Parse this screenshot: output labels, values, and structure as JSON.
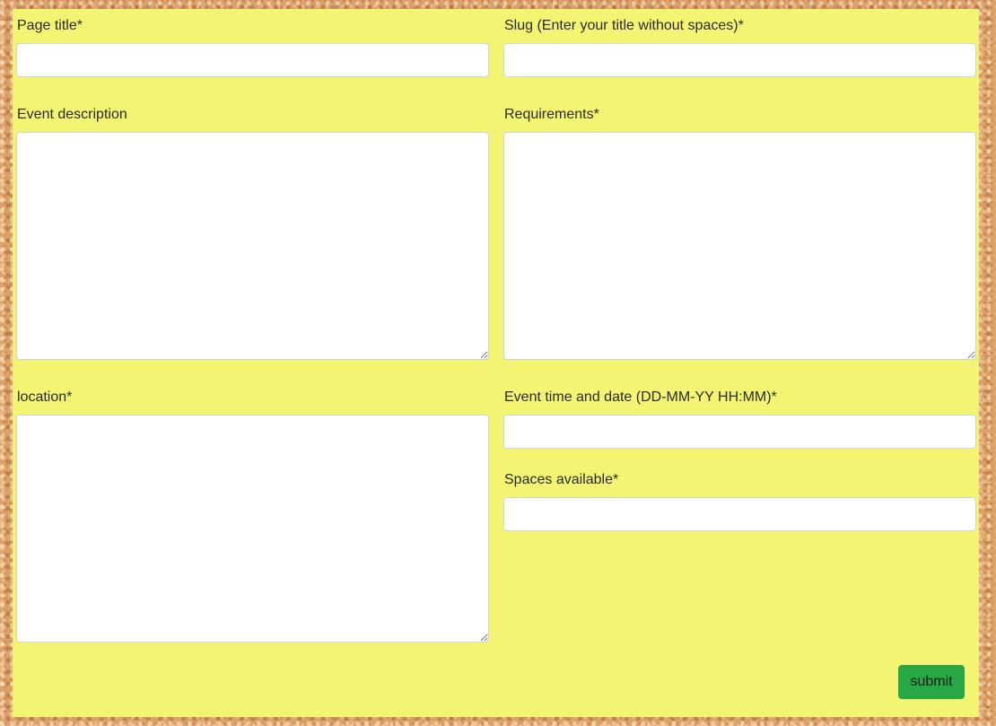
{
  "form": {
    "page_title": {
      "label": "Page title*",
      "value": ""
    },
    "slug": {
      "label": "Slug (Enter your title without spaces)*",
      "value": ""
    },
    "event_description": {
      "label": "Event description",
      "value": ""
    },
    "requirements": {
      "label": "Requirements*",
      "value": ""
    },
    "location": {
      "label": "location*",
      "value": ""
    },
    "event_time": {
      "label": "Event time and date (DD-MM-YY HH:MM)*",
      "value": ""
    },
    "spaces": {
      "label": "Spaces available*",
      "value": ""
    },
    "submit_label": "submit"
  },
  "colors": {
    "board": "#f3f471",
    "submit": "#28a745",
    "cork": "#dca06a"
  }
}
